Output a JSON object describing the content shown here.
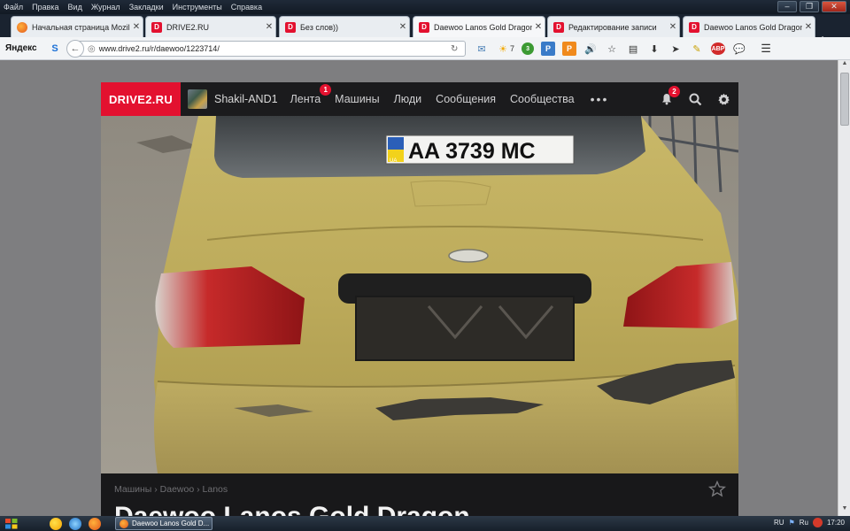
{
  "menu": [
    "Файл",
    "Правка",
    "Вид",
    "Журнал",
    "Закладки",
    "Инструменты",
    "Справка"
  ],
  "window_controls": [
    "–",
    "❐",
    "✕"
  ],
  "tabs": [
    {
      "title": "Начальная страница Mozill...",
      "icon": "firefox-icon",
      "active": false
    },
    {
      "title": "DRIVE2.RU",
      "icon": "drive2-favicon",
      "active": false
    },
    {
      "title": "Без слов))",
      "icon": "drive2-favicon",
      "active": false
    },
    {
      "title": "Daewoo Lanos Gold Dragon",
      "icon": "drive2-favicon",
      "active": true
    },
    {
      "title": "Редактирование записи",
      "icon": "drive2-favicon",
      "active": false
    },
    {
      "title": "Daewoo Lanos Gold Dragon",
      "icon": "drive2-favicon",
      "active": false
    }
  ],
  "new_tab": "+",
  "toolbar": {
    "yandex": "Яндекс",
    "url": "www.drive2.ru/r/daewoo/1223714/",
    "weather": "7",
    "icons": [
      "yandex-search-icon",
      "mail-icon",
      "weather-icon",
      "green-badge-icon",
      "p-icon",
      "orange-icon",
      "sound-icon",
      "bookmark-star-icon",
      "clipboard-icon",
      "download-icon",
      "send-icon",
      "pencil-icon",
      "adblock-icon",
      "chat-icon",
      "menu-icon"
    ],
    "adblock": "ABP"
  },
  "site": {
    "logo": "DRIVE2.RU",
    "username": "Shakil-AND1",
    "nav": [
      {
        "label": "Лента",
        "badge": "1"
      },
      {
        "label": "Машины",
        "badge": null
      },
      {
        "label": "Люди",
        "badge": null
      },
      {
        "label": "Сообщения",
        "badge": null
      },
      {
        "label": "Сообщества",
        "badge": null
      }
    ],
    "more": "•••",
    "notifications_badge": "2",
    "breadcrumb": "Машины › Daewoo › Lanos",
    "article_title": "Daewoo Lanos Gold Dragon",
    "photo": {
      "plate_text": "AA 3739 MC",
      "plate_country": "UA"
    }
  },
  "taskbar": {
    "window_title": "Daewoo Lanos Gold D...",
    "lang": "RU",
    "tray_lang": "Ru",
    "time": "17:20"
  }
}
